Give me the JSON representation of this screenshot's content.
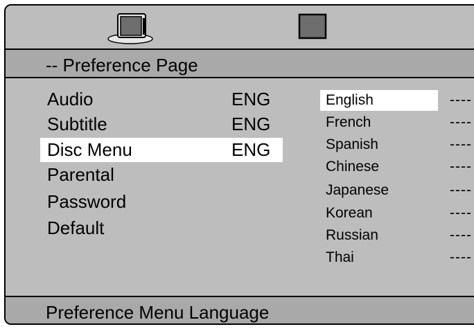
{
  "header": {
    "icons": [
      "tv-icon",
      "preference-icon"
    ]
  },
  "title": "-- Preference Page",
  "menu": [
    {
      "label": "Audio",
      "value": "ENG"
    },
    {
      "label": "Subtitle",
      "value": "ENG"
    },
    {
      "label": "Disc Menu",
      "value": "ENG",
      "selected": true
    },
    {
      "label": "Parental",
      "value": ""
    },
    {
      "label": "Password",
      "value": ""
    },
    {
      "label": "Default",
      "value": ""
    }
  ],
  "options": [
    {
      "label": "English",
      "selected": true
    },
    {
      "label": "French"
    },
    {
      "label": "Spanish"
    },
    {
      "label": "Chinese"
    },
    {
      "label": "Japanese"
    },
    {
      "label": "Korean"
    },
    {
      "label": "Russian"
    },
    {
      "label": "Thai"
    }
  ],
  "option_suffix": "----",
  "footer": "Preference Menu Language",
  "colors": {
    "background": "#bdbdbd",
    "bar": "#a9a9a9",
    "highlight": "#ffffff"
  }
}
